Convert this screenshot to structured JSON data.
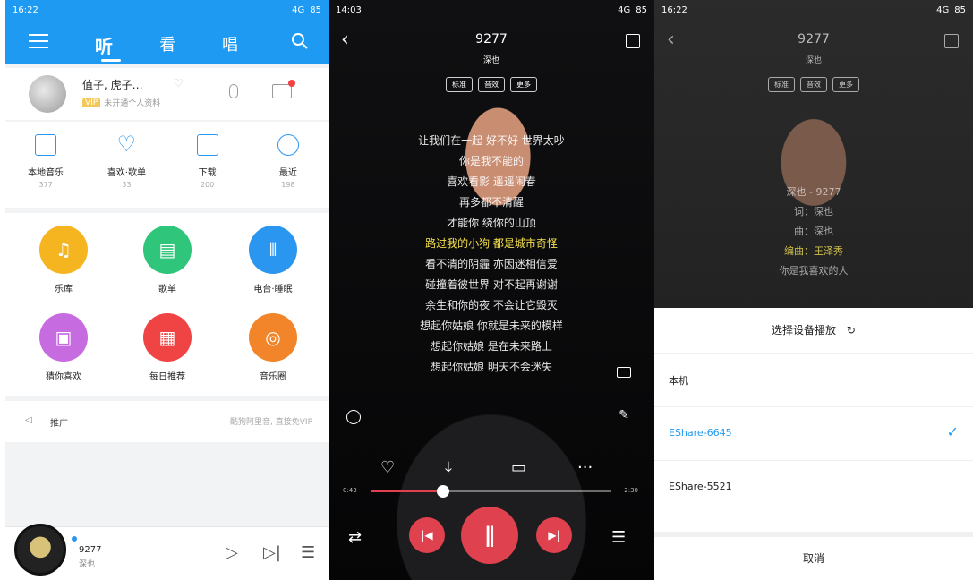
{
  "panel1": {
    "status": {
      "time": "16:22",
      "signal": "4G",
      "battery": "85"
    },
    "nav": {
      "tabs": [
        "听",
        "看",
        "唱"
      ]
    },
    "profile": {
      "name": "值子, 虎子…",
      "vip_tag": "VIP",
      "vip_text": "未开通个人资料"
    },
    "quick": [
      {
        "label": "本地音乐",
        "count": "377"
      },
      {
        "label": "喜欢·歌单",
        "count": "33"
      },
      {
        "label": "下载",
        "count": "200"
      },
      {
        "label": "最近",
        "count": "198"
      }
    ],
    "grid": [
      {
        "label": "乐库",
        "color": "#f5b521",
        "icon": "music-note-icon"
      },
      {
        "label": "歌单",
        "color": "#2fc57a",
        "icon": "playlist-icon"
      },
      {
        "label": "电台·睡眠",
        "color": "#2b96f0",
        "icon": "radio-wave-icon"
      },
      {
        "label": "猜你喜欢",
        "color": "#c66be0",
        "icon": "radio-icon"
      },
      {
        "label": "每日推荐",
        "color": "#f04343",
        "icon": "calendar-icon"
      },
      {
        "label": "音乐圈",
        "color": "#f2842a",
        "icon": "music-circle-icon"
      }
    ],
    "promo": {
      "label": "推广",
      "right": "酷狗阿里音, 直接免VIP"
    },
    "mini": {
      "song": "9277",
      "artist": "深也"
    }
  },
  "panel2": {
    "status": {
      "time": "14:03",
      "signal": "4G",
      "battery": "85"
    },
    "title": "9277",
    "artist": "深也",
    "pills": [
      "标准",
      "音效",
      "更多"
    ],
    "lyrics": [
      "让我们在一起 好不好 世界太吵",
      "你是我不能的",
      "喜欢看影 遥遥闹春",
      "再多都不清醒",
      "才能你 绕你的山顶",
      "路过我的小狗 都是城市奇怪",
      "看不清的阴霾 亦因迷相信爱",
      "碰撞着彼世界 对不起再谢谢",
      "余生和你的夜 不会让它毁灭",
      "想起你姑娘 你就是未来的模样",
      "想起你姑娘 是在未来路上",
      "想起你姑娘 明天不会迷失"
    ],
    "time_current": "0:43",
    "time_total": "2:30",
    "progress": 0.3
  },
  "panel3": {
    "status": {
      "time": "16:22",
      "signal": "4G",
      "battery": "85"
    },
    "title": "9277",
    "artist": "深也",
    "pills": [
      "标准",
      "音效",
      "更多"
    ],
    "lyrics": [
      "深也 - 9277",
      "词：深也",
      "曲：深也",
      "编曲：王泽秀",
      "你是我喜欢的人"
    ],
    "sheet_title": "选择设备播放",
    "devices": [
      "本机",
      "EShare-6645",
      "EShare-5521"
    ],
    "selected_device": "EShare-6645",
    "cancel": "取消"
  }
}
